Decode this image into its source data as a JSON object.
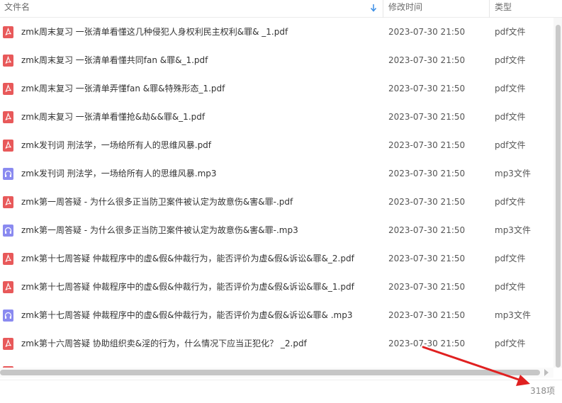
{
  "header": {
    "name_label": "文件名",
    "time_label": "修改时间",
    "type_label": "类型",
    "sort_icon": "sort-down-arrow-icon"
  },
  "files": [
    {
      "icon": "pdf-file-icon",
      "name": "zmk周末复习 一张清单看懂这几种侵犯人身权利民主权利&罪& _1.pdf",
      "time": "2023-07-30 21:50",
      "type": "pdf文件"
    },
    {
      "icon": "pdf-file-icon",
      "name": "zmk周末复习 一张清单看懂共同fan &罪&_1.pdf",
      "time": "2023-07-30 21:50",
      "type": "pdf文件"
    },
    {
      "icon": "pdf-file-icon",
      "name": "zmk周末复习  一张清单弄懂fan &罪&特殊形态_1.pdf",
      "time": "2023-07-30 21:50",
      "type": "pdf文件"
    },
    {
      "icon": "pdf-file-icon",
      "name": "zmk周末复习 一张清单看懂抢&劫&&罪&_1.pdf",
      "time": "2023-07-30 21:50",
      "type": "pdf文件"
    },
    {
      "icon": "pdf-file-icon",
      "name": "zmk发刊词  刑法学，一场给所有人的思维风暴.pdf",
      "time": "2023-07-30 21:50",
      "type": "pdf文件"
    },
    {
      "icon": "mp3-file-icon",
      "name": "zmk发刊词  刑法学，一场给所有人的思维风暴.mp3",
      "time": "2023-07-30 21:50",
      "type": "mp3文件"
    },
    {
      "icon": "pdf-file-icon",
      "name": "zmk第一周答疑 - 为什么很多正当防卫案件被认定为故意伤&害&罪-.pdf",
      "time": "2023-07-30 21:50",
      "type": "pdf文件"
    },
    {
      "icon": "mp3-file-icon",
      "name": "zmk第一周答疑 - 为什么很多正当防卫案件被认定为故意伤&害&罪-.mp3",
      "time": "2023-07-30 21:50",
      "type": "mp3文件"
    },
    {
      "icon": "pdf-file-icon",
      "name": "zmk第十七周答疑 仲裁程序中的虚&假&仲裁行为，能否评价为虚&假&诉讼&罪&_2.pdf",
      "time": "2023-07-30 21:50",
      "type": "pdf文件"
    },
    {
      "icon": "pdf-file-icon",
      "name": "zmk第十七周答疑 仲裁程序中的虚&假&仲裁行为，能否评价为虚&假&诉讼&罪&_1.pdf",
      "time": "2023-07-30 21:50",
      "type": "pdf文件"
    },
    {
      "icon": "mp3-file-icon",
      "name": "zmk第十七周答疑 仲裁程序中的虚&假&仲裁行为，能否评价为虚&假&诉讼&罪& .mp3",
      "time": "2023-07-30 21:50",
      "type": "mp3文件"
    },
    {
      "icon": "pdf-file-icon",
      "name": "zmk第十六周答疑   协助组织卖&淫的行为，什么情况下应当正犯化？ _2.pdf",
      "time": "2023-07-30 21:50",
      "type": "pdf文件"
    },
    {
      "icon": "pdf-file-icon",
      "name": "",
      "time": "",
      "type": ""
    }
  ],
  "footer": {
    "count": "318项"
  },
  "colors": {
    "pdf": "#e8595a",
    "mp3": "#8a8af0",
    "annotation_arrow": "#e02020"
  }
}
